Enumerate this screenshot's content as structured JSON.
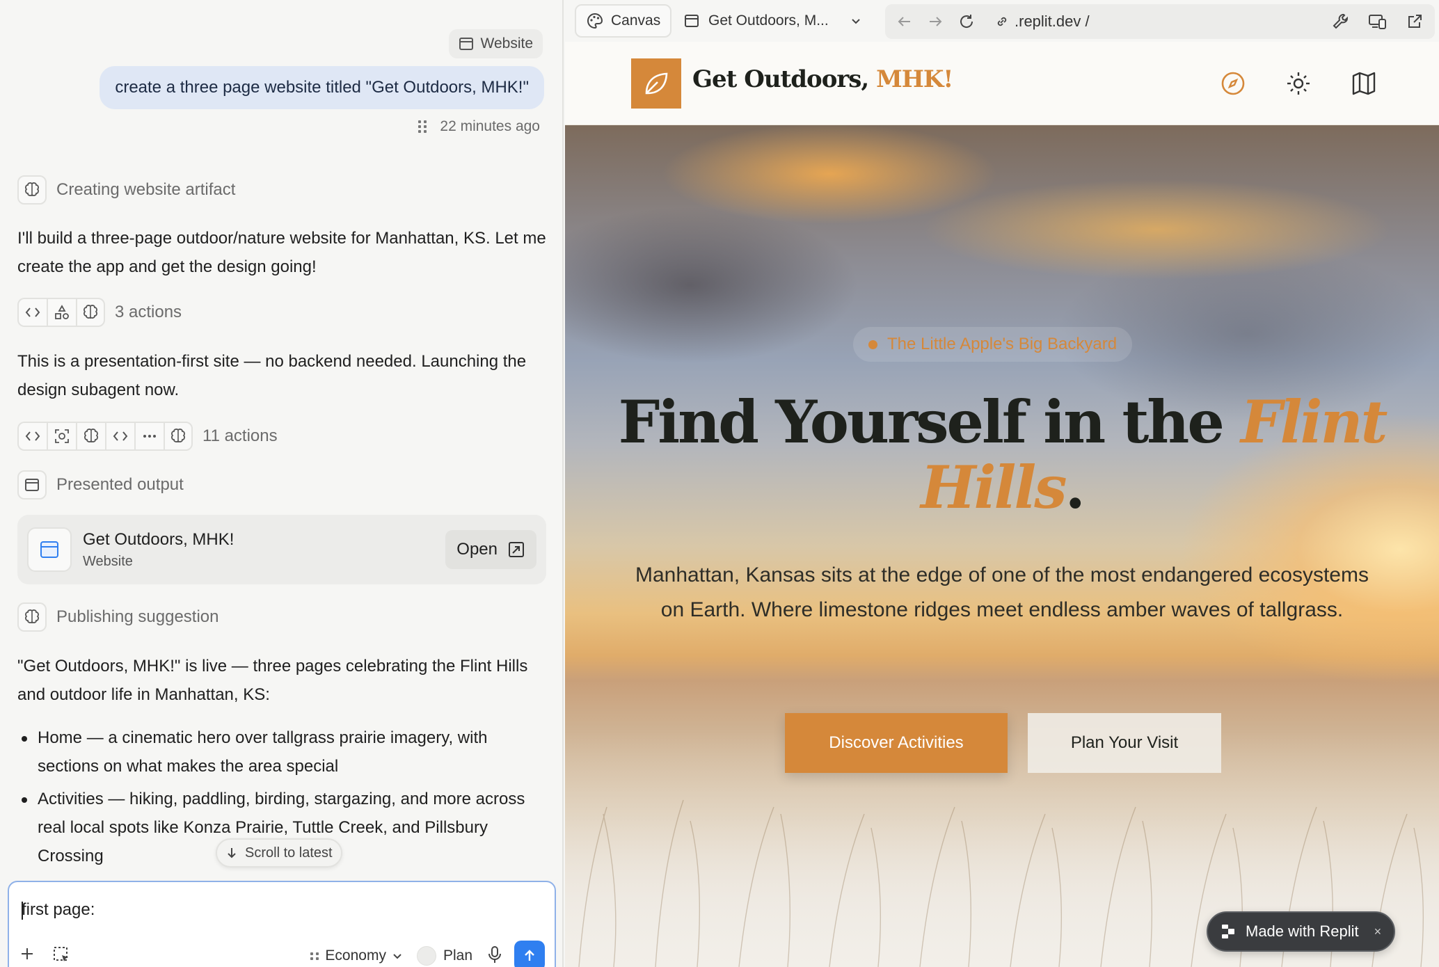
{
  "chat": {
    "website_chip": "Website",
    "user_message": "create a three page website titled \"Get Outdoors, MHK!\"",
    "timestamp": "22 minutes ago",
    "step1_label": "Creating website artifact",
    "para1": "I'll build a three-page outdoor/nature website for Manhattan, KS. Let me create the app and get the design going!",
    "actions1": "3 actions",
    "para2": "This is a presentation-first site — no backend needed. Launching the design subagent now.",
    "actions2": "11 actions",
    "step2_label": "Presented output",
    "artifact": {
      "title": "Get Outdoors, MHK!",
      "subtitle": "Website",
      "open_label": "Open"
    },
    "step3_label": "Publishing suggestion",
    "para3": "\"Get Outdoors, MHK!\" is live — three pages celebrating the Flint Hills and outdoor life in Manhattan, KS:",
    "bullets": [
      "Home — a cinematic hero over tallgrass prairie imagery, with sections on what makes the area special",
      "Activities — hiking, paddling, birding, stargazing, and more across real local spots like Konza Prairie, Tuttle Creek, and Pillsbury Crossing"
    ],
    "scroll_latest": "Scroll to latest",
    "composer": {
      "value": "first page:",
      "mode": "Economy",
      "plan_label": "Plan"
    }
  },
  "browser": {
    "canvas_tab": "Canvas",
    "page_tab": "Get Outdoors, M...",
    "url": ".replit.dev /"
  },
  "site": {
    "brand_main": "Get Outdoors, ",
    "brand_accent": "MHK!",
    "eyebrow": "The Little Apple's Big Backyard",
    "headline_main": "Find Yourself in the ",
    "headline_accent": "Flint Hills",
    "headline_end": ".",
    "copy": "Manhattan, Kansas sits at the edge of one of the most endangered ecosystems on Earth. Where limestone ridges meet endless amber waves of tallgrass.",
    "cta_primary": "Discover Activities",
    "cta_secondary": "Plan Your Visit",
    "badge": "Made with Replit",
    "badge_close": "×"
  },
  "colors": {
    "accent": "#d5883a",
    "ink": "#1e211c",
    "user_bubble": "#dfe7f5",
    "send_button": "#2f7ff0"
  },
  "icons": {
    "chat_steps": [
      "brain-icon",
      "window-icon",
      "brain-icon"
    ],
    "actions1": [
      "code-icon",
      "shapes-icon",
      "brain-icon"
    ],
    "actions2": [
      "code-icon",
      "screenshot-icon",
      "brain-icon",
      "code-icon",
      "more-icon",
      "brain-icon"
    ],
    "nav": [
      "compass-icon",
      "sun-icon",
      "map-icon"
    ]
  }
}
